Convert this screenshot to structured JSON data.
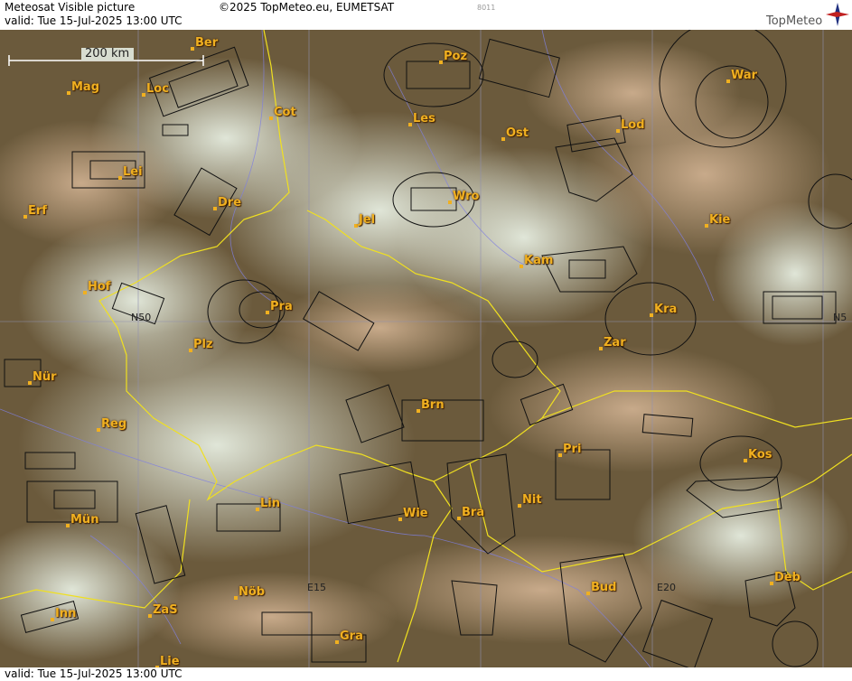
{
  "header": {
    "title": "Meteosat Visible picture",
    "copyright": "©2025 TopMeteo.eu, EUMETSAT",
    "code": "8011",
    "valid": "valid:  Tue  15-Jul-2025  13:00 UTC",
    "logo": "TopMeteo"
  },
  "footer": {
    "valid": "valid:  Tue  15-Jul-2025  13:00 UTC"
  },
  "scale": {
    "label": "200 km"
  },
  "grid_labels": {
    "n50": "N50",
    "e15": "E15",
    "e20": "E20",
    "n5": "N5"
  },
  "cities": [
    {
      "name": "Ber"
    },
    {
      "name": "Poz"
    },
    {
      "name": "War"
    },
    {
      "name": "Mag"
    },
    {
      "name": "Loc"
    },
    {
      "name": "Cot"
    },
    {
      "name": "Les"
    },
    {
      "name": "Ost"
    },
    {
      "name": "Lod"
    },
    {
      "name": "Lei"
    },
    {
      "name": "Dre"
    },
    {
      "name": "Wro"
    },
    {
      "name": "Erf"
    },
    {
      "name": "Jel"
    },
    {
      "name": "Kie"
    },
    {
      "name": "Kam"
    },
    {
      "name": "Hof"
    },
    {
      "name": "Pra"
    },
    {
      "name": "Kra"
    },
    {
      "name": "Plz"
    },
    {
      "name": "Zar"
    },
    {
      "name": "Nür"
    },
    {
      "name": "Brn"
    },
    {
      "name": "Reg"
    },
    {
      "name": "Pri"
    },
    {
      "name": "Kos"
    },
    {
      "name": "Lin"
    },
    {
      "name": "Wie"
    },
    {
      "name": "Bra"
    },
    {
      "name": "Nit"
    },
    {
      "name": "Mün"
    },
    {
      "name": "Nöb"
    },
    {
      "name": "Bud"
    },
    {
      "name": "Deb"
    },
    {
      "name": "Inn"
    },
    {
      "name": "ZaS"
    },
    {
      "name": "Gra"
    },
    {
      "name": "Lie"
    }
  ]
}
